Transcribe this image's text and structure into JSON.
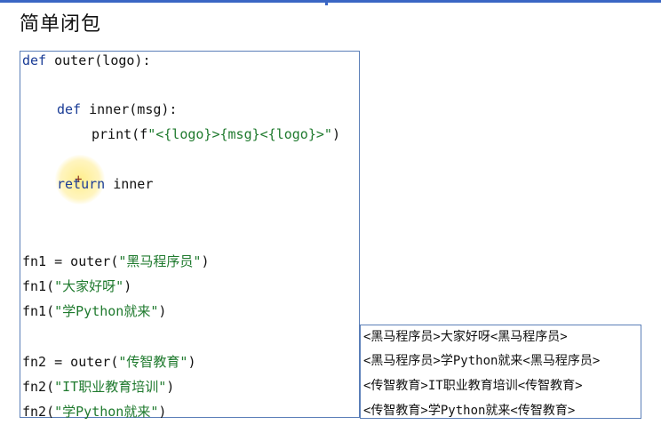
{
  "page": {
    "title": "简单闭包"
  },
  "code": {
    "line1": {
      "kw": "def",
      "rest": " outer(logo):"
    },
    "line2": {
      "kw": "def",
      "rest": " inner(msg):"
    },
    "line3": {
      "pre": "print(f",
      "str": "\"<{logo}>{msg}<{logo}>\"",
      "post": ")"
    },
    "line4": {
      "kw": "return",
      "rest": " inner"
    },
    "line5": {
      "pre": "fn1 = outer(",
      "str": "\"黑马程序员\"",
      "post": ")"
    },
    "line6": {
      "pre": "fn1(",
      "str": "\"大家好呀\"",
      "post": ")"
    },
    "line7": {
      "pre": "fn1(",
      "str": "\"学Python就来\"",
      "post": ")"
    },
    "line8": {
      "pre": "fn2 = outer(",
      "str": "\"传智教育\"",
      "post": ")"
    },
    "line9": {
      "pre": "fn2(",
      "str": "\"IT职业教育培训\"",
      "post": ")"
    },
    "line10": {
      "pre": "fn2(",
      "str": "\"学Python就来\"",
      "post": ")"
    }
  },
  "output": {
    "lines": [
      "<黑马程序员>大家好呀<黑马程序员>",
      "<黑马程序员>学Python就来<黑马程序员>",
      "<传智教育>IT职业教育培训<传智教育>",
      "<传智教育>学Python就来<传智教育>"
    ]
  },
  "icons": {
    "cursor": "crosshair-cursor-icon"
  },
  "colors": {
    "keyword": "#1a3c96",
    "string": "#1f7a2e",
    "border": "#5b7fb8"
  }
}
